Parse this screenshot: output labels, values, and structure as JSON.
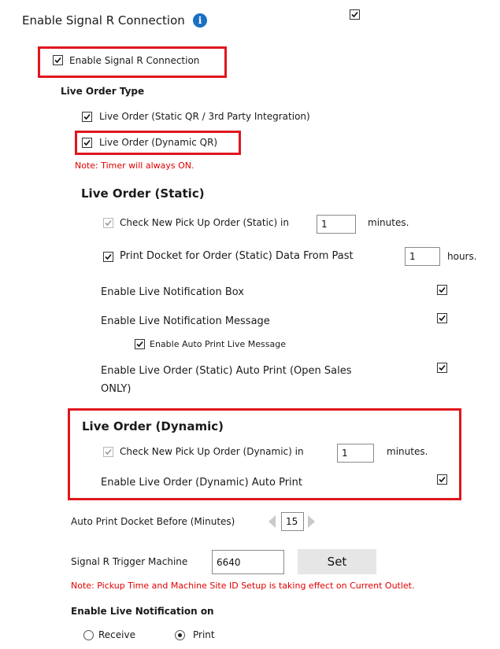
{
  "header": {
    "signalr_label": "Enable Signal R Connection",
    "info_icon_glyph": "i",
    "signalr_checked": true
  },
  "signalr_inner": {
    "label": "Enable Signal R Connection",
    "checked": true
  },
  "live_order_type": {
    "heading": "Live Order Type",
    "static_label": "Live Order (Static QR / 3rd Party Integration)",
    "dynamic_label": "Live Order (Dynamic QR)",
    "note": "Note: Timer will always ON."
  },
  "static_section": {
    "heading": "Live Order (Static)",
    "check_pickup_label": "Check New Pick Up Order (Static) in",
    "check_pickup_value": "1",
    "check_pickup_unit": "minutes.",
    "print_docket_label": "Print Docket for Order (Static) Data From Past",
    "print_docket_value": "1",
    "print_docket_unit": "hours.",
    "notification_box_label": "Enable Live Notification Box",
    "notification_message_label": "Enable Live Notification Message",
    "auto_print_message_label": "Enable Auto Print Live Message",
    "auto_print_line1": "Enable Live Order (Static) Auto Print (Open Sales",
    "auto_print_line2": "ONLY)"
  },
  "dynamic_section": {
    "heading": "Live Order (Dynamic)",
    "check_pickup_label": "Check New Pick Up Order (Dynamic) in",
    "check_pickup_value": "1",
    "check_pickup_unit": "minutes.",
    "auto_print_label": "Enable Live Order (Dynamic) Auto Print"
  },
  "auto_print_docket": {
    "label": "Auto Print Docket Before (Minutes)",
    "value": "15"
  },
  "trigger_machine": {
    "label": "Signal R Trigger Machine",
    "value": "6640",
    "set_button": "Set",
    "note": "Note: Pickup Time and Machine Site ID Setup is taking effect on Current Outlet."
  },
  "live_notification_on": {
    "heading": "Enable Live Notification on",
    "option_receive": "Receive",
    "option_print": "Print",
    "selected": "Print"
  },
  "colors": {
    "highlight": "#e0161e",
    "note": "#e00000",
    "info": "#1b6fc2",
    "button": "#e6e6e6"
  }
}
